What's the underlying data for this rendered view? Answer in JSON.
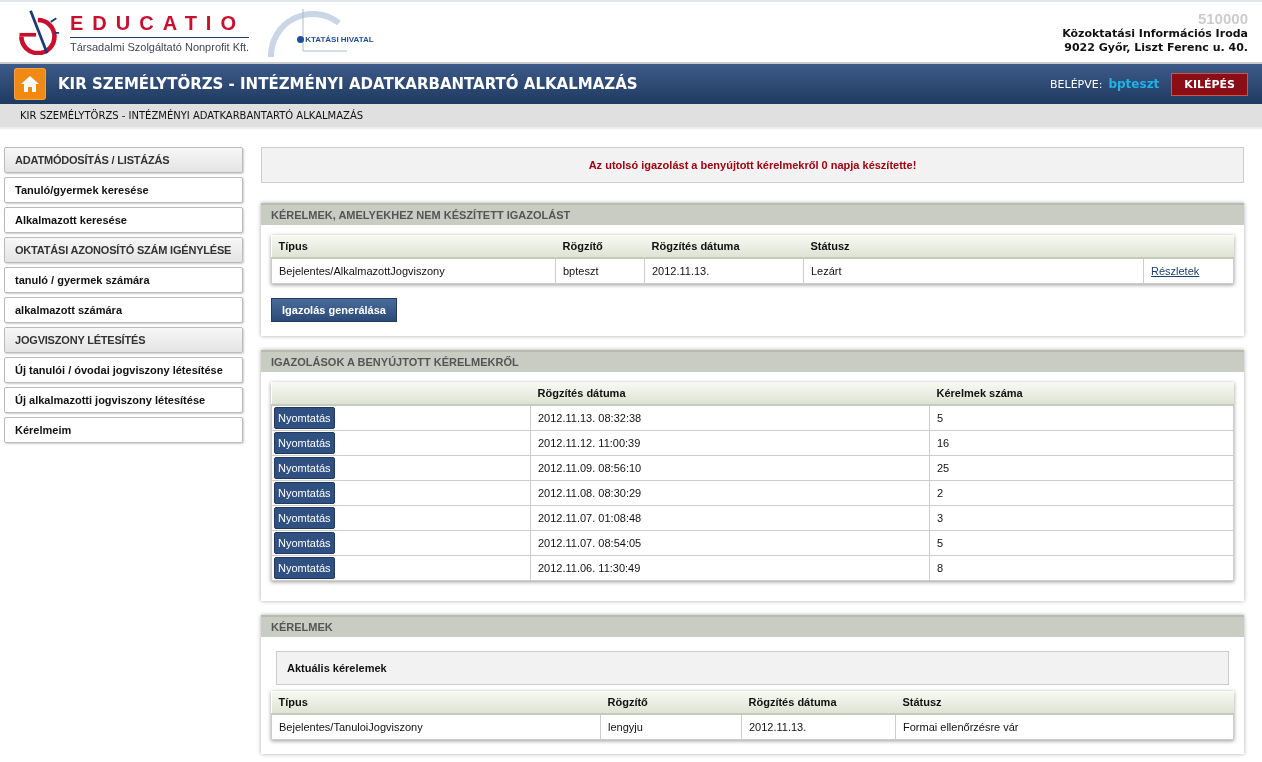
{
  "header": {
    "logo_name": "EDUCATIO",
    "logo_subtitle": "Társadalmi Szolgáltató Nonprofit Kft.",
    "partner_logo_text": "KTATÁSI HIVATAL",
    "code": "510000",
    "office": "Közoktatási Információs Iroda",
    "address": "9022 Győr, Liszt Ferenc u. 40."
  },
  "app_bar": {
    "title": "KIR SZEMÉLYTÖRZS - INTÉZMÉNYI ADATKARBANTARTÓ ALKALMAZÁS",
    "logged_in_label": "BELÉPVE:",
    "user": "bpteszt",
    "logout": "KILÉPÉS"
  },
  "breadcrumb": "KIR SZEMÉLYTÖRZS - INTÉZMÉNYI ADATKARBANTARTÓ ALKALMAZÁS",
  "sidebar": {
    "items": [
      {
        "kind": "header",
        "label": "ADATMÓDOSÍTÁS / LISTÁZÁS"
      },
      {
        "kind": "link",
        "label": "Tanuló/gyermek keresése"
      },
      {
        "kind": "link",
        "label": "Alkalmazott keresése"
      },
      {
        "kind": "header",
        "label": "OKTATÁSI AZONOSÍTÓ SZÁM IGÉNYLÉSE"
      },
      {
        "kind": "link",
        "label": "tanuló / gyermek számára"
      },
      {
        "kind": "link",
        "label": "alkalmazott számára"
      },
      {
        "kind": "header",
        "label": "JOGVISZONY LÉTESÍTÉS"
      },
      {
        "kind": "link",
        "label": "Új tanulói / óvodai jogviszony létesítése"
      },
      {
        "kind": "link",
        "label": "Új alkalmazotti jogviszony létesítése"
      },
      {
        "kind": "link",
        "label": "Kérelmeim"
      }
    ]
  },
  "notice": "Az utolsó igazolást a benyújtott kérelmekről 0 napja készítette!",
  "pending_panel": {
    "title": "KÉRELMEK, AMELYEKHEZ NEM KÉSZÍTETT IGAZOLÁST",
    "columns": [
      "Típus",
      "Rögzítő",
      "Rögzítés dátuma",
      "Státusz"
    ],
    "rows": [
      {
        "type": "Bejelentes/AlkalmazottJogviszony",
        "recorder": "bpteszt",
        "date": "2012.11.13.",
        "status": "Lezárt",
        "link": "Részletek"
      }
    ],
    "button": "Igazolás generálása"
  },
  "certificates_panel": {
    "title": "IGAZOLÁSOK A BENYÚJTOTT KÉRELMEKRŐL",
    "columns": [
      "Rögzítés dátuma",
      "Kérelmek száma"
    ],
    "rows": [
      {
        "button": "Nyomtatás",
        "date": "2012.11.13. 08:32:38",
        "count": "5"
      },
      {
        "button": "Nyomtatás",
        "date": "2012.11.12. 11:00:39",
        "count": "16"
      },
      {
        "button": "Nyomtatás",
        "date": "2012.11.09. 08:56:10",
        "count": "25"
      },
      {
        "button": "Nyomtatás",
        "date": "2012.11.08. 08:30:29",
        "count": "2"
      },
      {
        "button": "Nyomtatás",
        "date": "2012.11.07. 01:08:48",
        "count": "3"
      },
      {
        "button": "Nyomtatás",
        "date": "2012.11.07. 08:54:05",
        "count": "5"
      },
      {
        "button": "Nyomtatás",
        "date": "2012.11.06. 11:30:49",
        "count": "8"
      }
    ]
  },
  "requests_panel": {
    "title": "KÉRELMEK",
    "subtitle": "Aktuális kérelemek",
    "columns": [
      "Típus",
      "Rögzítő",
      "Rögzítés dátuma",
      "Státusz"
    ],
    "rows": [
      {
        "type": "Bejelentes/TanuloiJogviszony",
        "recorder": "lengyju",
        "date": "2012.11.13.",
        "status": "Formai ellenőrzésre vár"
      }
    ]
  }
}
